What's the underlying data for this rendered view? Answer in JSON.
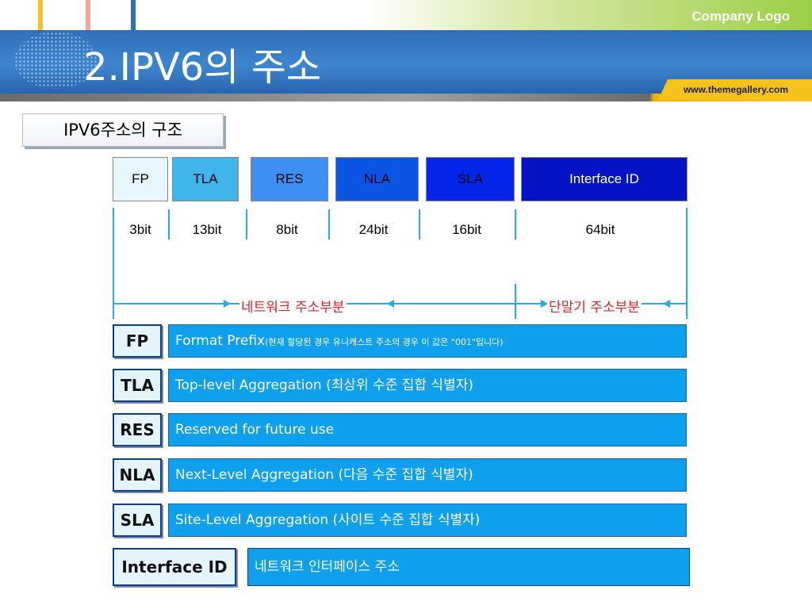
{
  "header": {
    "logo": "Company Logo",
    "title": "2.IPV6의 주소",
    "url": "www.themegallery.com"
  },
  "subtitle": "IPV6주소의 구조",
  "segments": [
    {
      "label": "FP",
      "bits": "3bit"
    },
    {
      "label": "TLA",
      "bits": "13bit"
    },
    {
      "label": "RES",
      "bits": "8bit"
    },
    {
      "label": "NLA",
      "bits": "24bit"
    },
    {
      "label": "SLA",
      "bits": "16bit"
    },
    {
      "label": "Interface ID",
      "bits": "64bit"
    }
  ],
  "ranges": {
    "network": "네트워크 주소부분",
    "host": "단말기 주소부분"
  },
  "definitions": [
    {
      "term": "FP",
      "desc": "Format Prefix",
      "note": "(현재 할당된 경우 유니캐스트 주소의 경우 이 값은 \"001\"입니다)"
    },
    {
      "term": "TLA",
      "desc": "Top-level Aggregation (최상위 수준 집합 식별자)"
    },
    {
      "term": "RES",
      "desc": "Reserved for future use"
    },
    {
      "term": "NLA",
      "desc": "Next-Level Aggregation (다음 수준 집합 식별자)"
    },
    {
      "term": "SLA",
      "desc": "Site-Level Aggregation (사이트 수준 집합 식별자)"
    },
    {
      "term": "Interface ID",
      "desc": "네트워크 인터페이스 주소"
    }
  ],
  "colors": {
    "title_bar": "#3c86cf",
    "accent_blue": "#0ea0ec",
    "range_red": "#e8202a",
    "tick_blue": "#2ba8e8"
  }
}
